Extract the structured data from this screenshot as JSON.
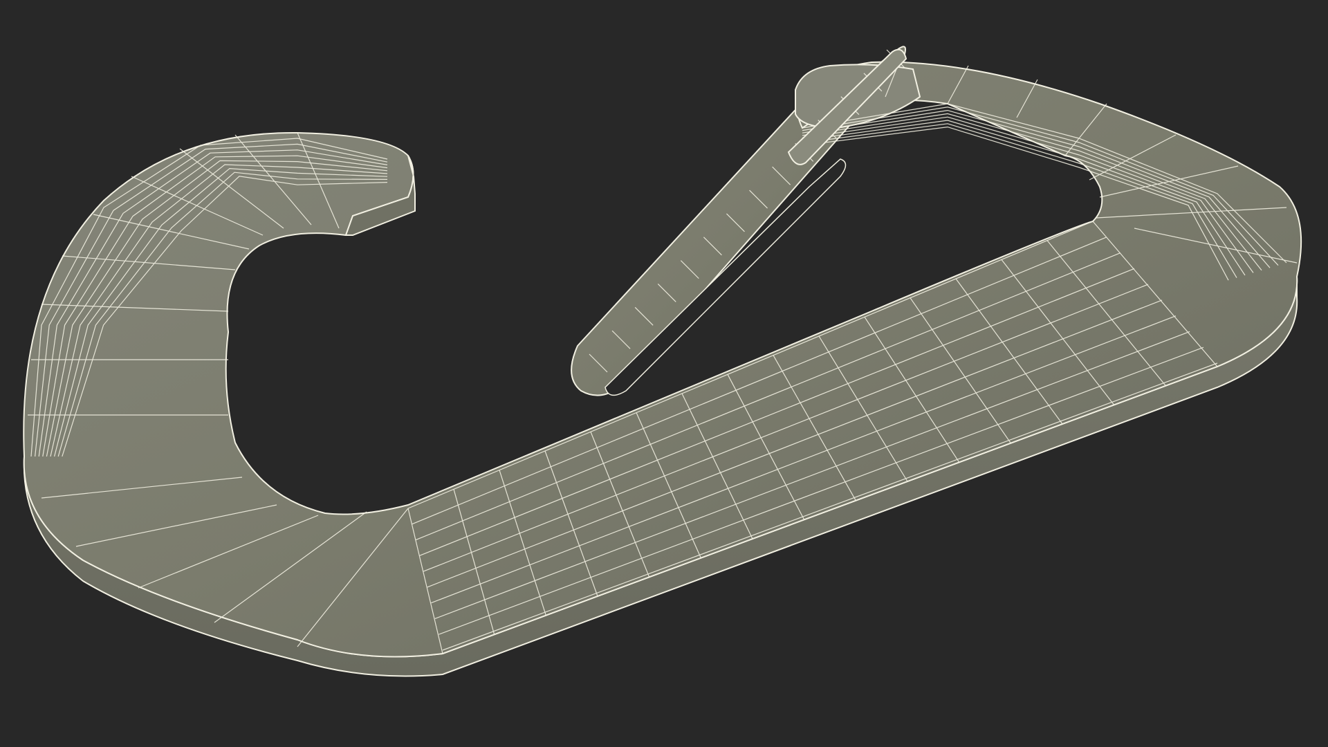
{
  "scene": {
    "subject": "carabiner-wireframe-model",
    "colors": {
      "background": "#282828",
      "surface": "#7b7c6d",
      "surface_dark": "#6a6b5e",
      "surface_light": "#8b8c7c",
      "wire": "#f2f0e2"
    }
  }
}
